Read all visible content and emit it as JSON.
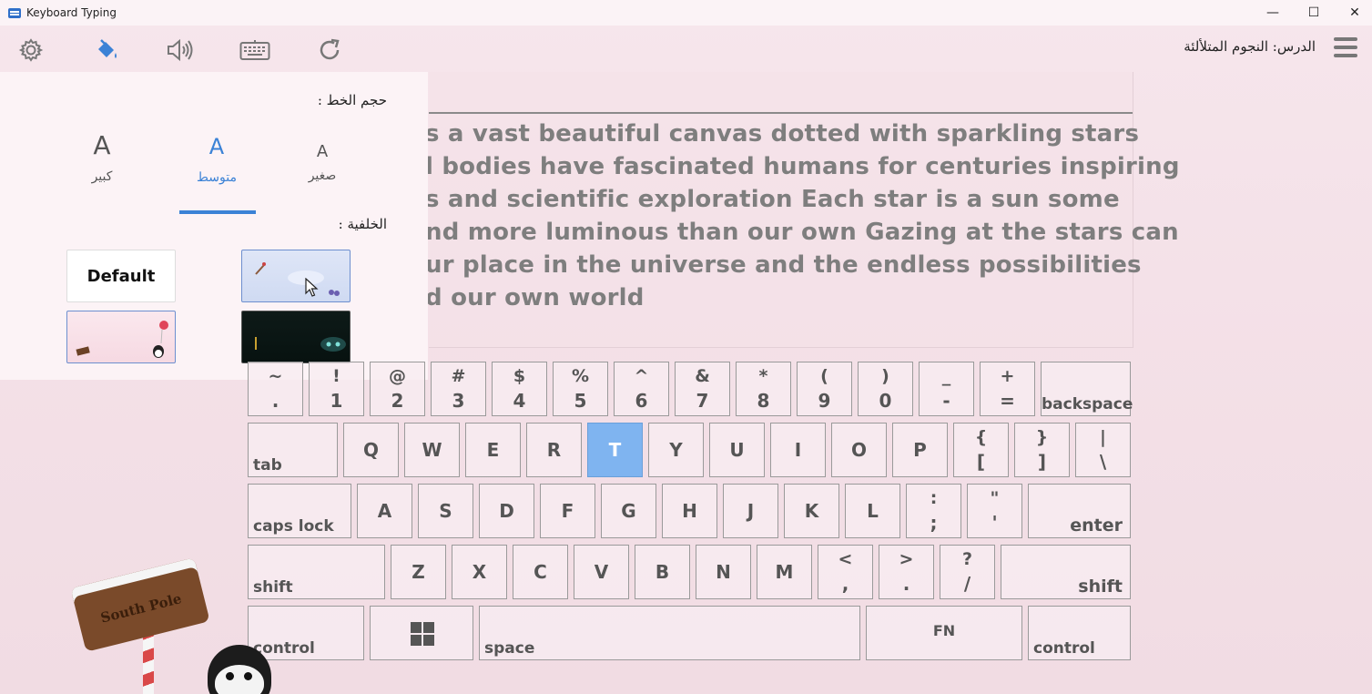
{
  "window": {
    "title": "Keyboard Typing",
    "minimize": "—",
    "maximize": "☐",
    "close": "✕"
  },
  "toolbar": {
    "icons": [
      "gear-icon",
      "paint-bucket-icon",
      "speaker-icon",
      "keyboard-icon",
      "refresh-icon"
    ],
    "accent_color": "#3b82d6"
  },
  "lesson": {
    "title": "الدرس: النجوم المتلألئة"
  },
  "text_lines": [
    "s a vast beautiful canvas dotted with sparkling stars",
    "l bodies have fascinated humans for centuries inspiring",
    "s and scientific exploration Each star is a sun some",
    "nd more luminous than our own Gazing at the stars can",
    "ur place in the universe and the endless possibilities",
    "d our own world"
  ],
  "panel": {
    "font_size_label": "حجم الخط :",
    "background_label": "الخلفية :",
    "sizes": [
      {
        "glyph": "A",
        "label": "كبير"
      },
      {
        "glyph": "A",
        "label": "متوسط"
      },
      {
        "glyph": "A",
        "label": "صغير"
      }
    ],
    "selected_size": "متوسط",
    "default_bg_label": "Default"
  },
  "keyboard": {
    "active_key": "T",
    "active_color": "#7fb4f0",
    "row1": [
      {
        "top": "~",
        "bot": "."
      },
      {
        "top": "!",
        "bot": "1"
      },
      {
        "top": "@",
        "bot": "2"
      },
      {
        "top": "#",
        "bot": "3"
      },
      {
        "top": "$",
        "bot": "4"
      },
      {
        "top": "%",
        "bot": "5"
      },
      {
        "top": "^",
        "bot": "6"
      },
      {
        "top": "&",
        "bot": "7"
      },
      {
        "top": "*",
        "bot": "8"
      },
      {
        "top": "(",
        "bot": "9"
      },
      {
        "top": ")",
        "bot": "0"
      },
      {
        "top": "_",
        "bot": "-"
      },
      {
        "top": "+",
        "bot": "="
      }
    ],
    "backspace": "backspace",
    "tab": "tab",
    "row2": [
      "Q",
      "W",
      "E",
      "R",
      "T",
      "Y",
      "U",
      "I",
      "O",
      "P"
    ],
    "row2_sym": [
      {
        "top": "{",
        "bot": "["
      },
      {
        "top": "}",
        "bot": "]"
      },
      {
        "top": "|",
        "bot": "\\"
      }
    ],
    "caps": "caps lock",
    "row3": [
      "A",
      "S",
      "D",
      "F",
      "G",
      "H",
      "J",
      "K",
      "L"
    ],
    "row3_sym": [
      {
        "top": ":",
        "bot": ";"
      },
      {
        "top": "\"",
        "bot": "'"
      }
    ],
    "enter": "enter",
    "shift_left": "shift",
    "row4": [
      "Z",
      "X",
      "C",
      "V",
      "B",
      "N",
      "M"
    ],
    "row4_sym": [
      {
        "top": "<",
        "bot": ","
      },
      {
        "top": ">",
        "bot": "."
      },
      {
        "top": "?",
        "bot": "/"
      }
    ],
    "shift_right": "shift",
    "control_left": "control",
    "space": "space",
    "fn": "FN",
    "control_right": "control"
  },
  "decoration": {
    "sign_text": "South Pole"
  }
}
